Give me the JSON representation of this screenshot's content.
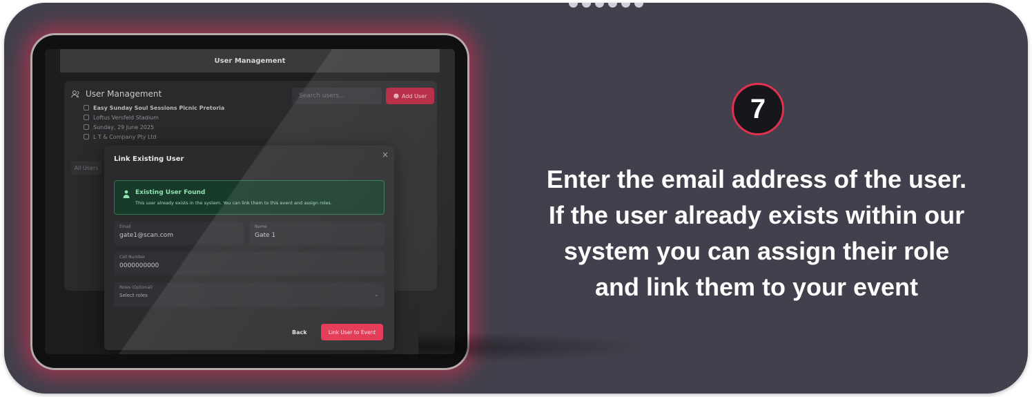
{
  "step_number": "7",
  "instruction_lines": [
    "Enter the email address of the user.",
    "If the user already exists within our",
    "system you can assign their role",
    "and link them to your event"
  ],
  "app": {
    "topbar_title": "User Management",
    "panel_title": "User Management",
    "event": {
      "name": "Easy Sunday Soul Sessions Picnic Pretoria",
      "venue": "Loftus Versfeld Stadium",
      "date": "Sunday, 29 June 2025",
      "company": "L T & Company Pty Ltd"
    },
    "search_placeholder": "Search users...",
    "add_user_label": "Add User",
    "all_users_label": "All Users"
  },
  "modal": {
    "title": "Link Existing User",
    "close_glyph": "×",
    "found_title": "Existing User Found",
    "found_desc": "This user already exists in the system. You can link them to this event and assign roles.",
    "email_label": "Email",
    "email_value": "gate1@scan.com",
    "name_label": "Name",
    "name_value": "Gate 1",
    "cell_label": "Cell Number",
    "cell_value": "0000000000",
    "roles_label": "Roles (Optional)",
    "roles_placeholder": "Select roles",
    "back_label": "Back",
    "link_label": "Link User to Event"
  },
  "colors": {
    "accent": "#e2304e",
    "card_bg": "#42404c",
    "success_bg": "#183a2a",
    "success_text": "#8ee3ae"
  }
}
